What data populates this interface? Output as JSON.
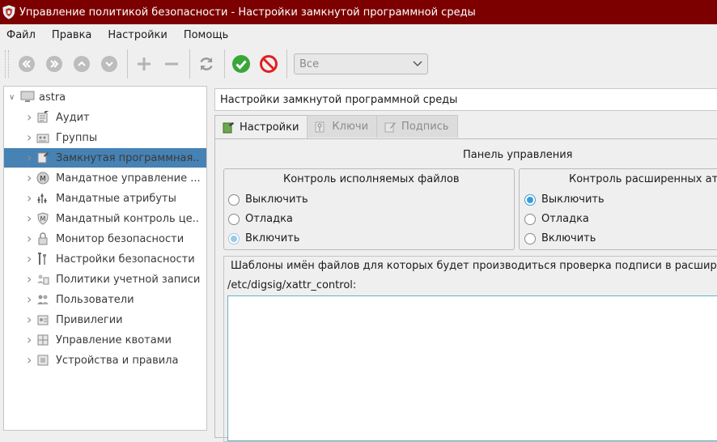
{
  "window": {
    "title": "Управление политикой безопасности - Настройки замкнутой программной среды"
  },
  "menu": [
    "Файл",
    "Правка",
    "Настройки",
    "Помощь"
  ],
  "toolbar": {
    "filter": {
      "value": "Все"
    }
  },
  "tree": {
    "root": "astra",
    "items": [
      {
        "label": "Аудит",
        "icon": "audit-icon"
      },
      {
        "label": "Группы",
        "icon": "groups-icon"
      },
      {
        "label": "Замкнутая программная...",
        "icon": "closed-env-icon",
        "selected": true
      },
      {
        "label": "Мандатное управление ...",
        "icon": "mandatory-control-icon"
      },
      {
        "label": "Мандатные атрибуты",
        "icon": "mandatory-attrs-icon"
      },
      {
        "label": "Мандатный контроль це...",
        "icon": "integrity-control-icon"
      },
      {
        "label": "Монитор безопасности",
        "icon": "security-monitor-icon"
      },
      {
        "label": "Настройки безопасности",
        "icon": "security-settings-icon"
      },
      {
        "label": "Политики учетной записи",
        "icon": "account-policy-icon"
      },
      {
        "label": "Пользователи",
        "icon": "users-icon"
      },
      {
        "label": "Привилегии",
        "icon": "privileges-icon"
      },
      {
        "label": "Управление квотами",
        "icon": "quotas-icon"
      },
      {
        "label": "Устройства и правила",
        "icon": "devices-icon"
      }
    ]
  },
  "main": {
    "path": "Настройки замкнутой программной среды",
    "tabs": [
      {
        "label": "Настройки",
        "active": true
      },
      {
        "label": "Ключи",
        "active": false
      },
      {
        "label": "Подпись",
        "active": false
      }
    ],
    "panel_title": "Панель управления",
    "exec_control": {
      "title": "Контроль исполняемых файлов",
      "options": [
        "Выключить",
        "Отладка",
        "Включить"
      ],
      "selected": "Включить"
    },
    "xattr_control": {
      "title": "Контроль расширенных атр",
      "options": [
        "Выключить",
        "Отладка",
        "Включить"
      ],
      "selected": "Выключить"
    },
    "templates": {
      "title": "Шаблоны имён файлов для которых будет производиться проверка подписи в расшире",
      "path": "/etc/digsig/xattr_control:"
    }
  }
}
